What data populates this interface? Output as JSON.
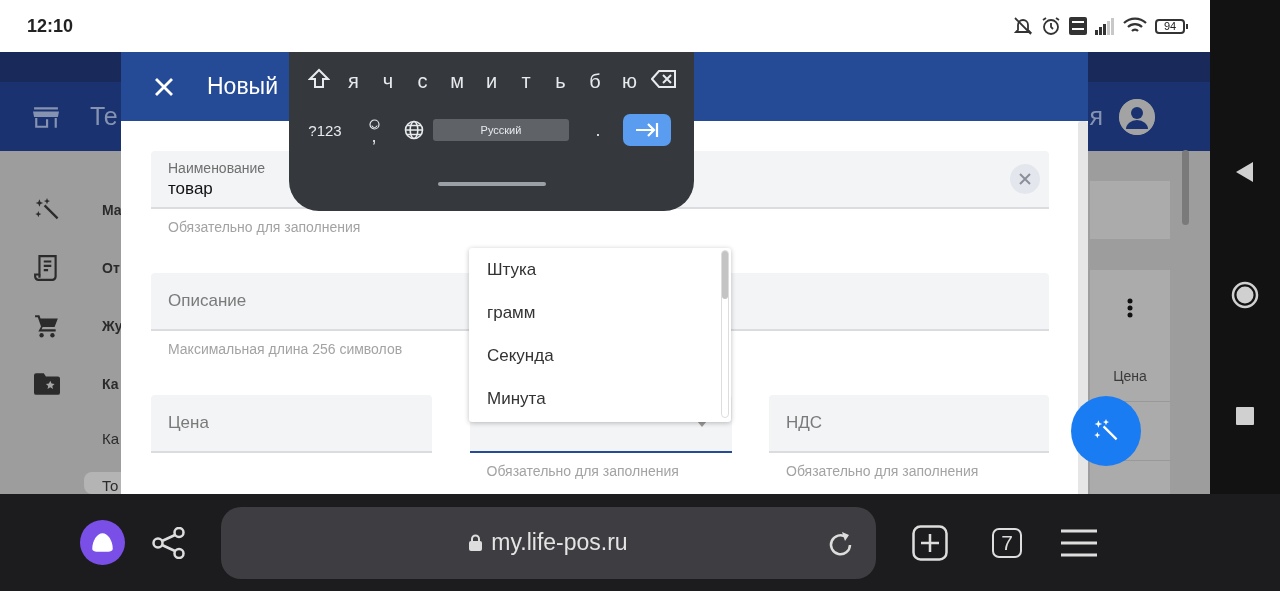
{
  "status_bar": {
    "time": "12:10",
    "battery": "94"
  },
  "app": {
    "title": "Те",
    "user_text": "я",
    "sidebar": [
      {
        "label": "Ма",
        "selected": false
      },
      {
        "label": "От",
        "selected": false
      },
      {
        "label": "Жу",
        "selected": false
      },
      {
        "label": "Ка",
        "selected": false
      },
      {
        "label": "Ка",
        "selected": false
      },
      {
        "label": "То",
        "selected": true
      }
    ],
    "table": {
      "column": "Цена"
    }
  },
  "dialog": {
    "title": "Новый",
    "fields": [
      {
        "kind": "text",
        "label": "Наименование",
        "value": "товар",
        "clearable": true,
        "helper": "Обязательно для заполнения"
      },
      {
        "kind": "text",
        "label": "Описание",
        "helper": "Максимальная длина 256 символов"
      }
    ],
    "row_fields": [
      {
        "kind": "text",
        "label": "Цена"
      },
      {
        "kind": "select",
        "focused": true,
        "helper": "Обязательно для заполнения"
      },
      {
        "kind": "text",
        "label": "НДС",
        "helper": "Обязательно для заполнения"
      }
    ],
    "dropdown": {
      "options": [
        "Штука",
        "грамм",
        "Секунда",
        "Минута"
      ]
    }
  },
  "keyboard": {
    "letters": [
      "я",
      "ч",
      "с",
      "м",
      "и",
      "т",
      "ь",
      "б",
      "ю"
    ],
    "symbols_key": "?123",
    "comma_key": ",",
    "space_key": "Русский",
    "period_key": "."
  },
  "browser": {
    "url": "my.life-pos.ru",
    "tab_count": "7"
  }
}
